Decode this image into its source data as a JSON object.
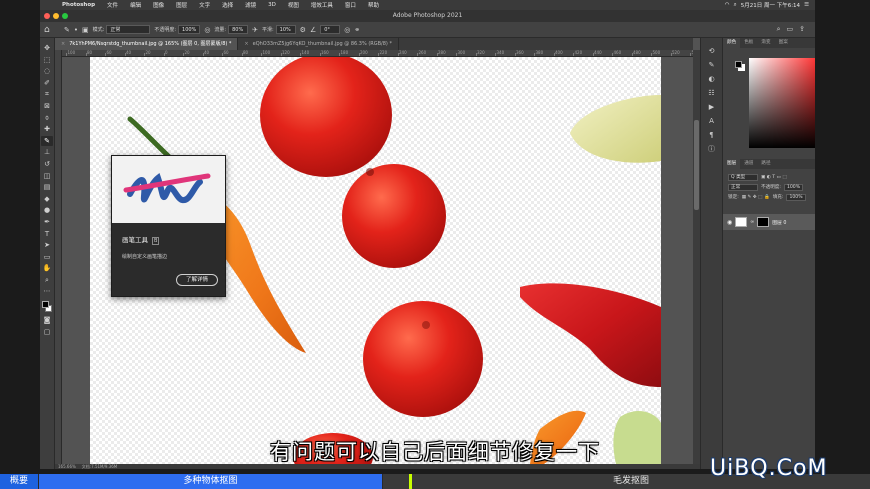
{
  "menubar": {
    "app_name": "Photoshop",
    "items": [
      "文件",
      "编辑",
      "图像",
      "图层",
      "文字",
      "选择",
      "滤镜",
      "3D",
      "视图",
      "增效工具",
      "窗口",
      "帮助"
    ],
    "clock": "5月21日 周一 下午6:14"
  },
  "window": {
    "title": "Adobe Photoshop 2021"
  },
  "options": {
    "mode_label": "模式:",
    "mode_value": "正常",
    "opacity_label": "不透明度:",
    "opacity_value": "100%",
    "flow_label": "流量:",
    "flow_value": "80%",
    "smooth_label": "平滑:",
    "smooth_value": "10%",
    "angle_value": "0°"
  },
  "tabs": [
    {
      "label": "7k1YhPM6/Nsqrstdg_thumbnail.jpg @ 165% (图层 0, 图层蒙版/8) *",
      "active": true
    },
    {
      "label": "eQhO33mZ5jg6YqKO_thumbnail.jpg @ 86.3% (RGB/8) *",
      "active": false
    }
  ],
  "ruler_labels": [
    "100",
    "80",
    "60",
    "40",
    "20",
    "0",
    "20",
    "40",
    "60",
    "80",
    "100",
    "120",
    "140",
    "160",
    "180",
    "200",
    "220",
    "240",
    "260",
    "280",
    "300",
    "320",
    "340",
    "360",
    "380",
    "400",
    "420",
    "440",
    "460",
    "480",
    "500",
    "520",
    "540"
  ],
  "tooltip": {
    "title": "画笔工具",
    "shortcut": "B",
    "description": "绘制自定义画笔描边",
    "learn_more": "了解详情"
  },
  "status": {
    "zoom": "165.66%",
    "doc": "文档:7.51M/9.36M"
  },
  "panels": {
    "top_tabs": [
      "颜色",
      "色板",
      "渐变",
      "图案"
    ],
    "layer_tabs": [
      "图层",
      "通道",
      "路径"
    ],
    "kind_label": "Q 类型",
    "blend_value": "正常",
    "opacity_label": "不透明度:",
    "opacity_value": "100%",
    "lock_label": "锁定:",
    "fill_label": "填充:",
    "fill_value": "100%",
    "layer_name": "图层 0"
  },
  "video": {
    "subtitle": "有问题可以自己后面细节修复一下",
    "chapters": [
      "概要",
      "多种物体抠图",
      "毛发抠图"
    ],
    "watermark": "UiBQ.CoM"
  },
  "colors": {
    "tomato": "#e3231a",
    "pepper_orange": "#f58a1f",
    "pepper_red": "#d11f1f",
    "pepper_yellow": "#e8e6a5",
    "chapter_blue": "#2e6df0"
  }
}
